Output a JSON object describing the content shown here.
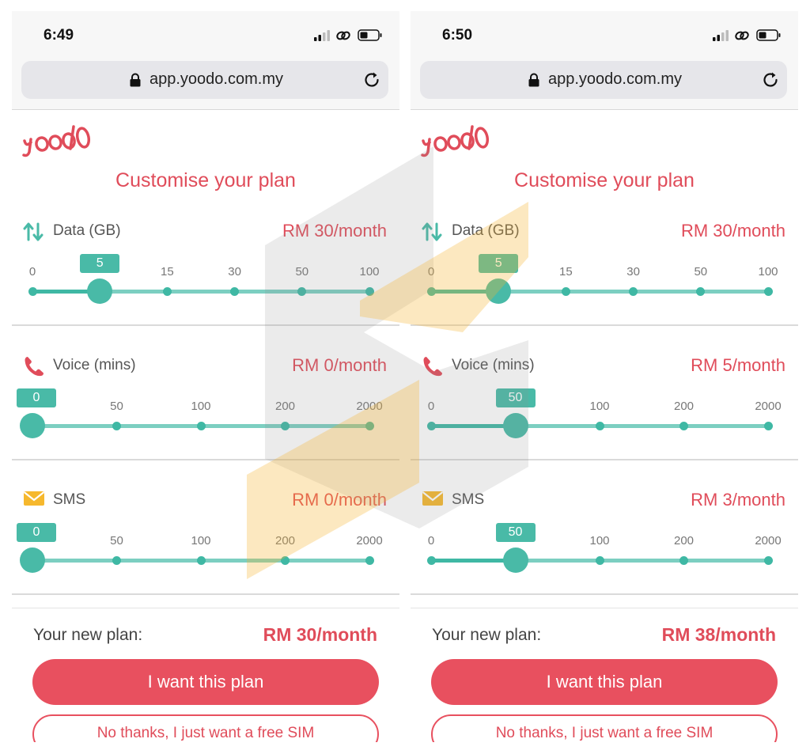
{
  "browser": {
    "url": "app.yoodo.com.my"
  },
  "screens": {
    "left": {
      "time": "6:49",
      "total": "RM 30/month",
      "sliders": {
        "data": {
          "price": "RM 30/month",
          "ticks": [
            "0",
            "5",
            "15",
            "30",
            "50",
            "100"
          ],
          "selected": "5",
          "selected_index": 1
        },
        "voice": {
          "price": "RM 0/month",
          "ticks": [
            "0",
            "50",
            "100",
            "200",
            "2000"
          ],
          "selected": "0",
          "selected_index": 0
        },
        "sms": {
          "price": "RM 0/month",
          "ticks": [
            "0",
            "50",
            "100",
            "200",
            "2000"
          ],
          "selected": "0",
          "selected_index": 0
        }
      }
    },
    "right": {
      "time": "6:50",
      "total": "RM 38/month",
      "sliders": {
        "data": {
          "price": "RM 30/month",
          "ticks": [
            "0",
            "5",
            "15",
            "30",
            "50",
            "100"
          ],
          "selected": "5",
          "selected_index": 1
        },
        "voice": {
          "price": "RM 5/month",
          "ticks": [
            "0",
            "50",
            "100",
            "200",
            "2000"
          ],
          "selected": "50",
          "selected_index": 1
        },
        "sms": {
          "price": "RM 3/month",
          "ticks": [
            "0",
            "50",
            "100",
            "200",
            "2000"
          ],
          "selected": "50",
          "selected_index": 1
        }
      }
    }
  },
  "labels": {
    "logo": "yoodo",
    "title": "Customise your plan",
    "data": "Data (GB)",
    "voice": "Voice (mins)",
    "sms": "SMS",
    "total_label": "Your new plan:",
    "cta": "I want this plan",
    "secondary": "No thanks, I just want a free SIM"
  },
  "icons": {
    "data": "arrows-up-down-icon",
    "voice": "phone-icon",
    "sms": "envelope-icon",
    "lock": "lock-icon",
    "reload": "reload-icon"
  },
  "colors": {
    "brand": "#e04c5a",
    "button": "#e8505f",
    "slider": "#49baa7",
    "slider_track": "#7ccfc1",
    "sms_icon": "#f6b82d"
  }
}
